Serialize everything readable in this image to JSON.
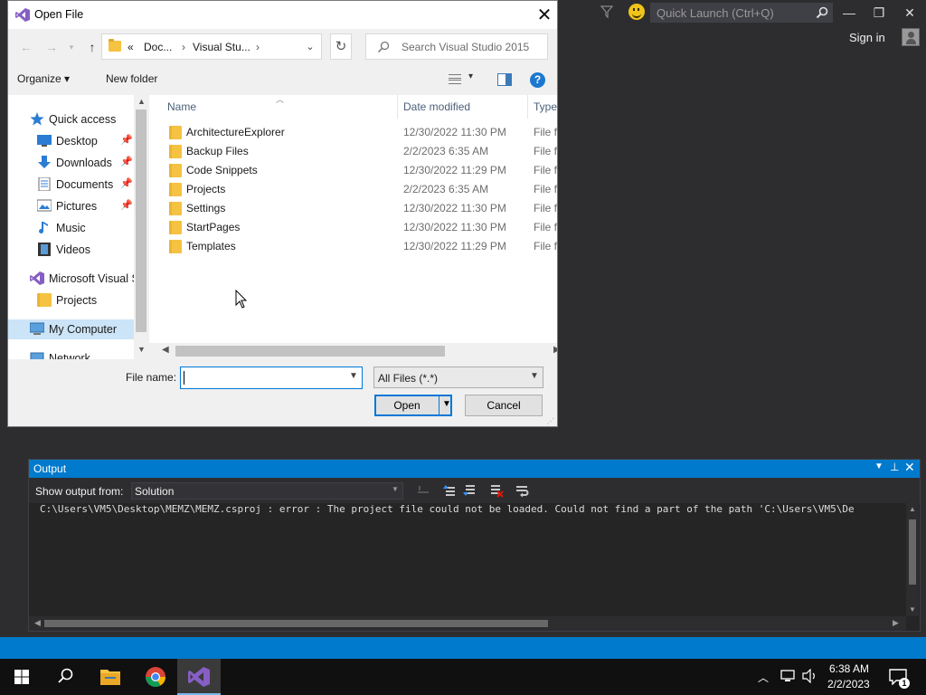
{
  "vs": {
    "quick_launch_placeholder": "Quick Launch (Ctrl+Q)",
    "sign_in": "Sign in",
    "minimize": "—",
    "restore": "❐",
    "close": "✕"
  },
  "dialog": {
    "title": "Open File",
    "close": "✕",
    "address": {
      "overflow": "«",
      "crumbs": [
        "Doc...",
        "Visual Stu..."
      ],
      "separator": "›",
      "dropdown": "⌄",
      "refresh": "↻"
    },
    "nav_buttons": {
      "back": "←",
      "forward": "→",
      "recent": "▾",
      "up": "↑"
    },
    "search_placeholder": "Search Visual Studio 2015",
    "toolbar": {
      "organize": "Organize ▾",
      "new_folder": "New folder",
      "view_caret": "▾",
      "help": "?"
    },
    "nav_pane": [
      {
        "label": "Quick access",
        "icon": "star-icon"
      },
      {
        "label": "Desktop",
        "icon": "desktop-icon",
        "pinned": true
      },
      {
        "label": "Downloads",
        "icon": "download-icon",
        "pinned": true
      },
      {
        "label": "Documents",
        "icon": "documents-icon",
        "pinned": true
      },
      {
        "label": "Pictures",
        "icon": "pictures-icon",
        "pinned": true
      },
      {
        "label": "Music",
        "icon": "music-icon"
      },
      {
        "label": "Videos",
        "icon": "videos-icon"
      },
      {
        "label": "Microsoft Visual S",
        "icon": "visual-studio-icon"
      },
      {
        "label": "Projects",
        "icon": "folder-icon"
      },
      {
        "label": "My Computer",
        "icon": "computer-icon",
        "selected": true
      },
      {
        "label": "Network",
        "icon": "network-icon"
      }
    ],
    "pin_glyph": "📌",
    "columns": {
      "name": "Name",
      "date": "Date modified",
      "type": "Type"
    },
    "files": [
      {
        "name": "ArchitectureExplorer",
        "date": "12/30/2022 11:30 PM",
        "type": "File fo"
      },
      {
        "name": "Backup Files",
        "date": "2/2/2023 6:35 AM",
        "type": "File fo"
      },
      {
        "name": "Code Snippets",
        "date": "12/30/2022 11:29 PM",
        "type": "File fo"
      },
      {
        "name": "Projects",
        "date": "2/2/2023 6:35 AM",
        "type": "File fo"
      },
      {
        "name": "Settings",
        "date": "12/30/2022 11:30 PM",
        "type": "File fo"
      },
      {
        "name": "StartPages",
        "date": "12/30/2022 11:30 PM",
        "type": "File fo"
      },
      {
        "name": "Templates",
        "date": "12/30/2022 11:29 PM",
        "type": "File fo"
      }
    ],
    "filename_label": "File name:",
    "filename_value": "",
    "filetype": "All Files (*.*)",
    "open": "Open",
    "cancel": "Cancel"
  },
  "output": {
    "title": "Output",
    "show_from_label": "Show output from:",
    "show_from_value": "Solution",
    "text": "C:\\Users\\VM5\\Desktop\\MEMZ\\MEMZ.csproj : error  : The project file could not be loaded. Could not find a part of the path 'C:\\Users\\VM5\\De"
  },
  "taskbar": {
    "time": "6:38 AM",
    "date": "2/2/2023",
    "notifications": "1",
    "chevron": "^"
  },
  "colors": {
    "accent": "#007acc",
    "vs_purple": "#865fc5",
    "dialog_focus": "#0078d7"
  }
}
